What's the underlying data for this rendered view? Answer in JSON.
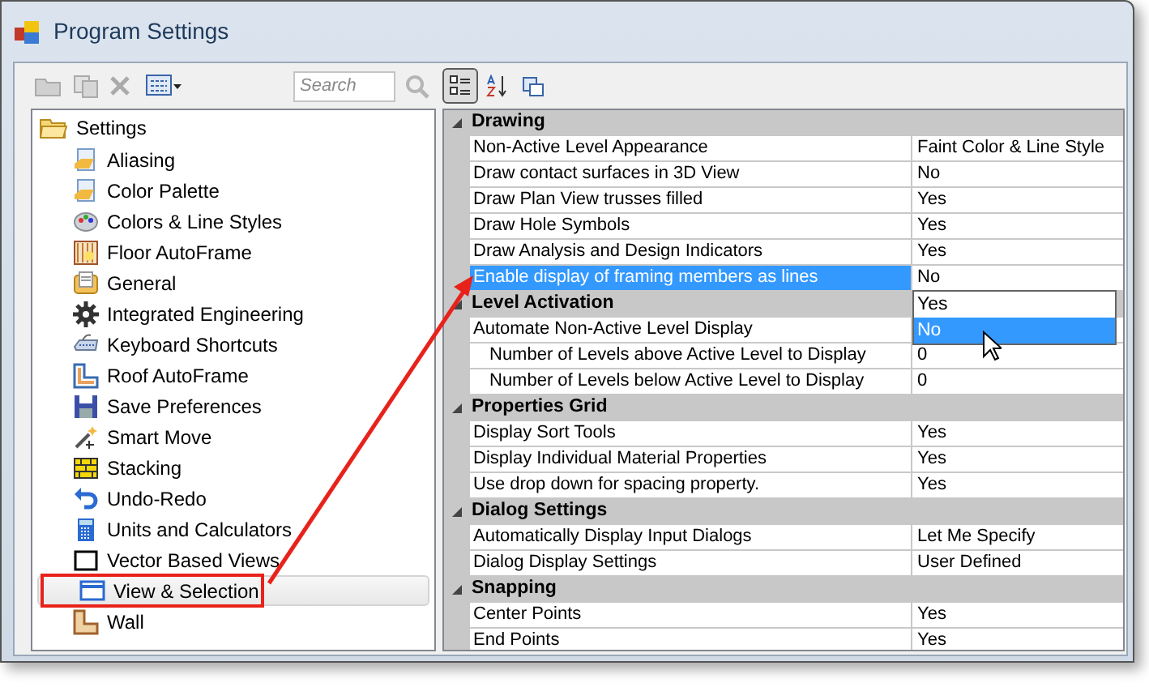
{
  "window": {
    "title": "Program Settings"
  },
  "toolbar": {
    "search": {
      "placeholder": "Search"
    },
    "view_buttons": [
      {
        "selected": true
      },
      {
        "selected": false
      },
      {
        "selected": false
      }
    ]
  },
  "tree": {
    "label": "Settings",
    "children": [
      {
        "label": "Aliasing",
        "selected": false
      },
      {
        "label": "Color Palette",
        "selected": false
      },
      {
        "label": "Colors & Line Styles",
        "selected": false
      },
      {
        "label": "Floor AutoFrame",
        "selected": false
      },
      {
        "label": "General",
        "selected": false
      },
      {
        "label": "Integrated Engineering",
        "selected": false
      },
      {
        "label": "Keyboard Shortcuts",
        "selected": false
      },
      {
        "label": "Roof AutoFrame",
        "selected": false
      },
      {
        "label": "Save Preferences",
        "selected": false
      },
      {
        "label": "Smart Move",
        "selected": false
      },
      {
        "label": "Stacking",
        "selected": false
      },
      {
        "label": "Undo-Redo",
        "selected": false
      },
      {
        "label": "Units and Calculators",
        "selected": false
      },
      {
        "label": "Vector Based Views",
        "selected": false
      },
      {
        "label": "View & Selection",
        "selected": true
      },
      {
        "label": "Wall",
        "selected": false
      }
    ]
  },
  "properties": {
    "categories": [
      {
        "name": "Drawing",
        "expanded": true,
        "rows": [
          {
            "name": "Non-Active Level Appearance",
            "value": "Faint Color & Line Style",
            "selected": false
          },
          {
            "name": "Draw contact surfaces in 3D View",
            "value": "No",
            "selected": false
          },
          {
            "name": "Draw Plan View trusses filled",
            "value": "Yes",
            "selected": false
          },
          {
            "name": "Draw Hole Symbols",
            "value": "Yes",
            "selected": false
          },
          {
            "name": "Draw Analysis and Design Indicators",
            "value": "Yes",
            "selected": false
          },
          {
            "name": "Enable display of framing members as lines",
            "value": "No",
            "selected": true
          }
        ]
      },
      {
        "name": "Level Activation",
        "expanded": true,
        "rows": [
          {
            "name": "Automate Non-Active Level Display",
            "selected": false,
            "children": [
              {
                "name": "Number of Levels above Active Level to Display",
                "value": "0",
                "selected": false
              },
              {
                "name": "Number of Levels below Active Level to Display",
                "value": "0",
                "selected": false
              }
            ]
          }
        ]
      },
      {
        "name": "Properties Grid",
        "expanded": true,
        "rows": [
          {
            "name": "Display Sort Tools",
            "value": "Yes",
            "selected": false
          },
          {
            "name": "Display Individual Material Properties",
            "value": "Yes",
            "selected": false
          },
          {
            "name": "Use drop down for spacing property.",
            "value": "Yes",
            "selected": false
          }
        ]
      },
      {
        "name": "Dialog Settings",
        "expanded": true,
        "rows": [
          {
            "name": "Automatically Display Input Dialogs",
            "value": "Let Me Specify",
            "selected": false
          },
          {
            "name": "Dialog Display Settings",
            "value": "User Defined",
            "selected": false
          }
        ]
      },
      {
        "name": "Snapping",
        "expanded": true,
        "rows": [
          {
            "name": "Center Points",
            "value": "Yes",
            "selected": false
          },
          {
            "name": "End Points",
            "value": "Yes",
            "selected": false
          }
        ]
      }
    ]
  },
  "dropdown": {
    "options": [
      {
        "label": "Yes",
        "selected": false
      },
      {
        "label": "No",
        "selected": true
      }
    ]
  }
}
